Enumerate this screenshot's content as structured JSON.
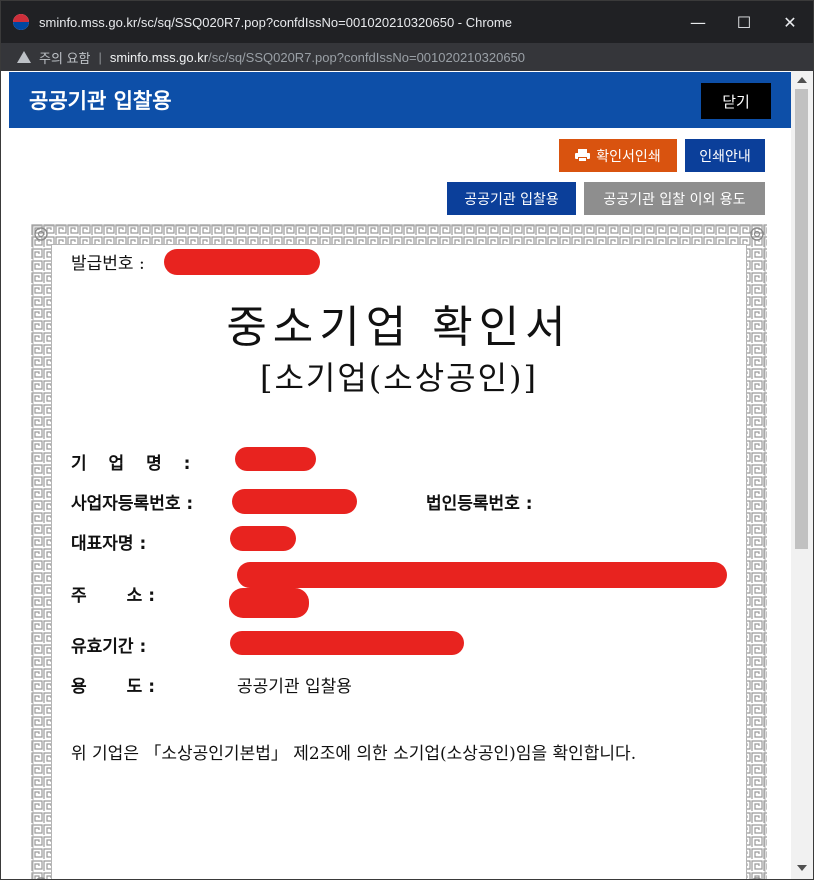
{
  "window": {
    "title": "sminfo.mss.go.kr/sc/sq/SSQ020R7.pop?confdIssNo=001020210320650 - Chrome",
    "minimize": "—",
    "maximize": "☐",
    "close": "✕"
  },
  "address": {
    "warning": "주의 요함",
    "host": "sminfo.mss.go.kr",
    "path": "/sc/sq/SSQ020R7.pop?confdIssNo=001020210320650"
  },
  "header": {
    "title": "공공기관 입찰용",
    "close_label": "닫기"
  },
  "toolbar": {
    "print_label": "확인서인쇄",
    "guide_label": "인쇄안내",
    "public_label": "공공기관 입찰용",
    "other_label": "공공기관 입찰 이외 용도"
  },
  "certificate": {
    "issue_label": "발급번호 :",
    "title": "중소기업 확인서",
    "subtitle": "[소기업(소상공인)]",
    "company_label": "기 업 명 :",
    "bizno_label": "사업자등록번호 :",
    "corpno_label": "법인등록번호 :",
    "ceo_label": "대표자명 :",
    "addr_label_a": "주",
    "addr_label_b": "소 :",
    "valid_label": "유효기간 :",
    "usage_label_a": "용",
    "usage_label_b": "도 :",
    "usage_value": "공공기관 입찰용",
    "statement": "위 기업은 「소상공인기본법」 제2조에 의한 소기업(소상공인)임을 확인합니다."
  },
  "colors": {
    "header_blue": "#0d4fa8",
    "print_orange": "#d9530f",
    "button_navy": "#0b3f9a",
    "button_gray": "#8e8e8e",
    "redaction_red": "#e8231f"
  },
  "icons": {
    "favicon": "taegeuk-icon",
    "warning": "warning-triangle-icon",
    "print": "printer-icon"
  }
}
